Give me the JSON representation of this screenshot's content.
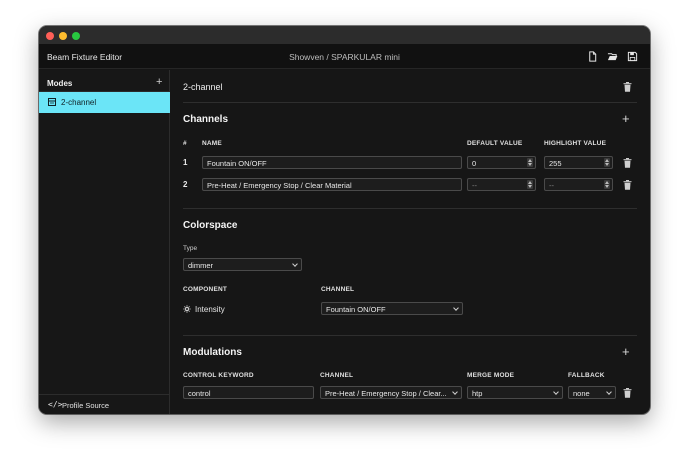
{
  "window": {
    "app_title": "Beam Fixture Editor",
    "doc_title": "Showven / SPARKULAR mini"
  },
  "toolbar": {
    "new_icon": "new-file-icon",
    "open_icon": "folder-open-icon",
    "save_icon": "save-icon"
  },
  "sidebar": {
    "heading": "Modes",
    "add_symbol": "+",
    "items": [
      {
        "label": "2-channel",
        "icon": "mode-icon",
        "selected": true
      }
    ],
    "footer": {
      "icon_glyph": "</>",
      "label": "Profile Source"
    },
    "accent": "#6be5f7"
  },
  "mode": {
    "name": "2-channel"
  },
  "channels": {
    "title": "Channels",
    "add_symbol": "+",
    "headers": {
      "num": "#",
      "name": "NAME",
      "default": "DEFAULT VALUE",
      "highlight": "HIGHLIGHT VALUE"
    },
    "rows": [
      {
        "num": "1",
        "name": "Fountain ON/OFF",
        "default": "0",
        "highlight": "255"
      },
      {
        "num": "2",
        "name": "Pre-Heat / Emergency Stop / Clear Material",
        "default": "--",
        "highlight": "--"
      }
    ]
  },
  "colorspace": {
    "title": "Colorspace",
    "type_label": "Type",
    "type_value": "dimmer",
    "component_header": "COMPONENT",
    "channel_header": "CHANNEL",
    "component": {
      "name": "Intensity",
      "icon": "sun-icon",
      "channel": "Fountain ON/OFF"
    }
  },
  "modulations": {
    "title": "Modulations",
    "add_symbol": "+",
    "headers": {
      "keyword": "CONTROL KEYWORD",
      "channel": "CHANNEL",
      "merge": "MERGE MODE",
      "fallback": "FALLBACK"
    },
    "rows": [
      {
        "keyword": "control",
        "channel": "Pre-Heat / Emergency Stop / Clear...",
        "merge": "htp",
        "fallback": "none"
      }
    ]
  }
}
